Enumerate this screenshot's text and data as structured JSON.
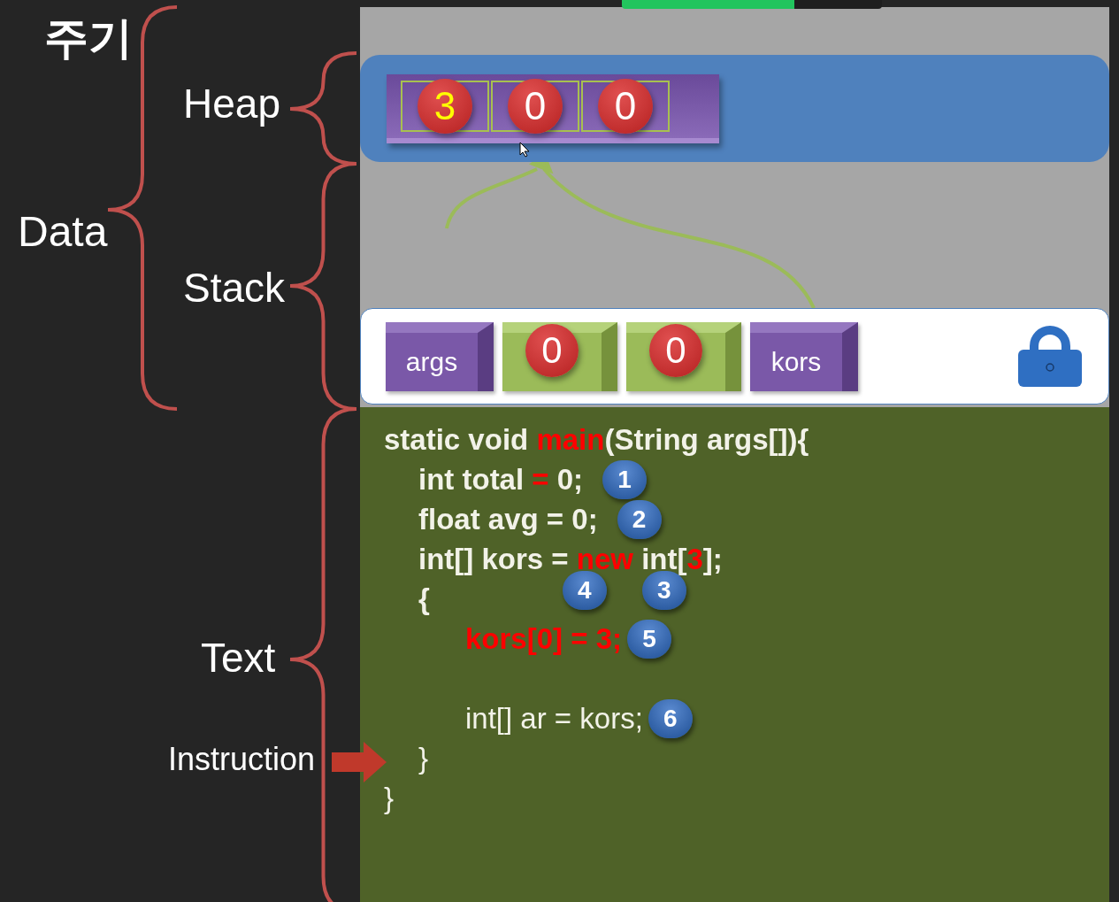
{
  "title": "주기",
  "memory_labels": [
    {
      "kind": "data",
      "label": "Data"
    },
    {
      "kind": "heap",
      "label": "Heap"
    },
    {
      "kind": "stack",
      "label": "Stack"
    },
    {
      "kind": "text",
      "label": "Text"
    },
    {
      "kind": "instruction",
      "label": "Instruction"
    }
  ],
  "heap": {
    "cells": [
      {
        "value": "3",
        "highlighted": true
      },
      {
        "value": "0",
        "highlighted": false
      },
      {
        "value": "0",
        "highlighted": false
      }
    ]
  },
  "stack": {
    "slots": [
      {
        "kind": "reference",
        "label": "args"
      },
      {
        "kind": "value",
        "value": "0"
      },
      {
        "kind": "value",
        "value": "0"
      },
      {
        "kind": "reference",
        "label": "kors"
      }
    ]
  },
  "code": {
    "lines": [
      {
        "kind": "top",
        "bold": true,
        "segments": [
          {
            "text": "static void ",
            "red": false
          },
          {
            "text": "main",
            "red": true
          },
          {
            "text": "(String args[]){",
            "red": false
          }
        ]
      },
      {
        "kind": "body",
        "bold": true,
        "segments": [
          {
            "text": "int total ",
            "red": false
          },
          {
            "text": "=",
            "red": true
          },
          {
            "text": " 0;",
            "red": false
          }
        ],
        "badges": [
          "1"
        ]
      },
      {
        "kind": "body",
        "bold": true,
        "segments": [
          {
            "text": "float avg = 0;",
            "red": false
          }
        ],
        "badges": [
          "2"
        ]
      },
      {
        "kind": "body",
        "bold": true,
        "segments": [
          {
            "text": "int[] kors = ",
            "red": false
          },
          {
            "text": "new",
            "red": true
          },
          {
            "text": " int[",
            "red": false
          },
          {
            "text": "3",
            "red": true
          },
          {
            "text": "];",
            "red": false
          }
        ]
      },
      {
        "kind": "body",
        "bold": true,
        "segments": [
          {
            "text": "{",
            "red": false
          }
        ],
        "badges": [
          "4",
          "3"
        ]
      },
      {
        "kind": "block",
        "bold": true,
        "segments": [
          {
            "text": "kors[0] = 3;",
            "red": true
          }
        ],
        "badges": [
          "5"
        ]
      },
      {
        "kind": "gap"
      },
      {
        "kind": "block",
        "bold": false,
        "segments": [
          {
            "text": "int[] ar = kors;",
            "red": false
          }
        ],
        "badges": [
          "6"
        ]
      },
      {
        "kind": "body",
        "bold": false,
        "segments": [
          {
            "text": "}",
            "red": false
          }
        ]
      },
      {
        "kind": "top",
        "bold": false,
        "segments": [
          {
            "text": "}",
            "red": false
          }
        ]
      }
    ]
  }
}
